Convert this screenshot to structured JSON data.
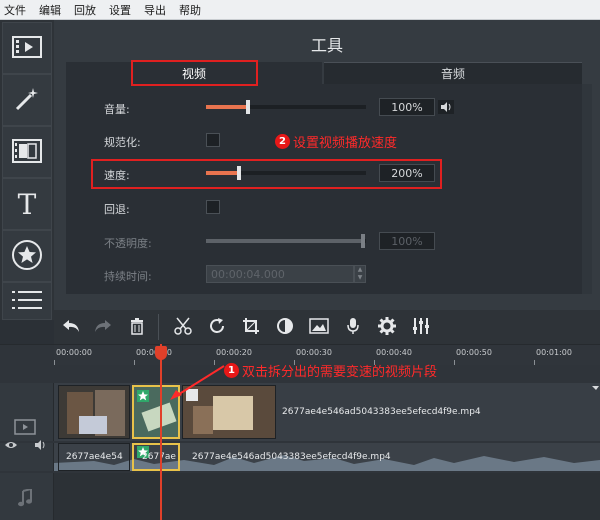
{
  "menu": [
    "文件",
    "编辑",
    "回放",
    "设置",
    "导出",
    "帮助"
  ],
  "sidebar": {
    "tools": [
      {
        "icon": "film-icon"
      },
      {
        "icon": "magic-wand-icon"
      },
      {
        "icon": "transition-icon"
      },
      {
        "icon": "text-icon",
        "glyph": "T"
      },
      {
        "icon": "sticker-icon"
      },
      {
        "icon": "menu-list-icon"
      }
    ]
  },
  "panel": {
    "title": "工具",
    "tabs": {
      "video": "视频",
      "audio": "音频"
    },
    "volume": {
      "label": "音量:",
      "value": "100%",
      "level": 0.26
    },
    "normalize": {
      "label": "规范化:"
    },
    "speed": {
      "label": "速度:",
      "value": "200%",
      "level": 0.2
    },
    "reverse": {
      "label": "回退:"
    },
    "opacity": {
      "label": "不透明度:",
      "value": "100%",
      "level": 0.98
    },
    "duration": {
      "label": "持续时间:",
      "value": "00:00:04.000"
    }
  },
  "annotations": {
    "step1": {
      "number": "1",
      "text": "双击拆分出的需要变速的视频片段"
    },
    "step2": {
      "number": "2",
      "text": "设置视频播放速度"
    }
  },
  "timeline": {
    "ticks": [
      "00:00:00",
      "00:00:10",
      "00:00:20",
      "00:00:30",
      "00:00:40",
      "00:00:50",
      "00:01:00"
    ],
    "video_clip_name": "2677ae4e546ad5043383ee5efecd4f9e.mp4",
    "audio_clip_names": [
      "2677ae4e54",
      "2677ae",
      "2677ae4e546ad5043383ee5efecd4f9e.mp4"
    ]
  },
  "colors": {
    "accent": "#e8744f",
    "highlight": "#e02020",
    "selected_clip": "#e8c24a",
    "playhead": "#e0402a"
  }
}
